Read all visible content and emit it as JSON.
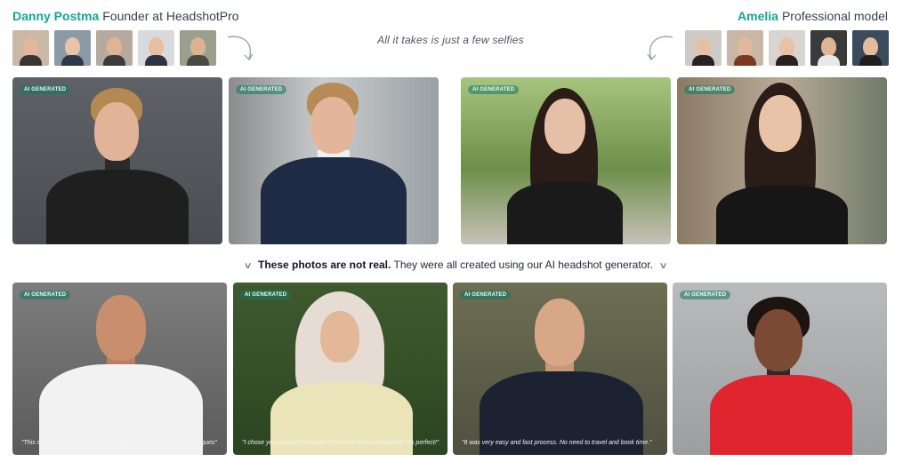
{
  "left_person": {
    "name": "Danny Postma",
    "role": "Founder at HeadshotPro"
  },
  "right_person": {
    "name": "Amelia",
    "role": "Professional model"
  },
  "tagline": "All it takes is just a few selfies",
  "badge_label": "AI GENERATED",
  "notice": {
    "strong": "These photos are not real.",
    "rest": "They were all created using our AI headshot generator."
  },
  "testimonials": [
    "\"This service is fantastic and I've already recommended it to collegues\"",
    "\"I chose your product because it's so real and professional. It's perfect!\"",
    "\"It was very easy and fast process. No need to travel and book time.\"",
    ""
  ],
  "icons": {
    "curl": "curved-arrow-icon",
    "chevron": "chevron-down-icon"
  },
  "colors": {
    "accent": "#14a594",
    "badge_bg": "#1f7a68"
  }
}
